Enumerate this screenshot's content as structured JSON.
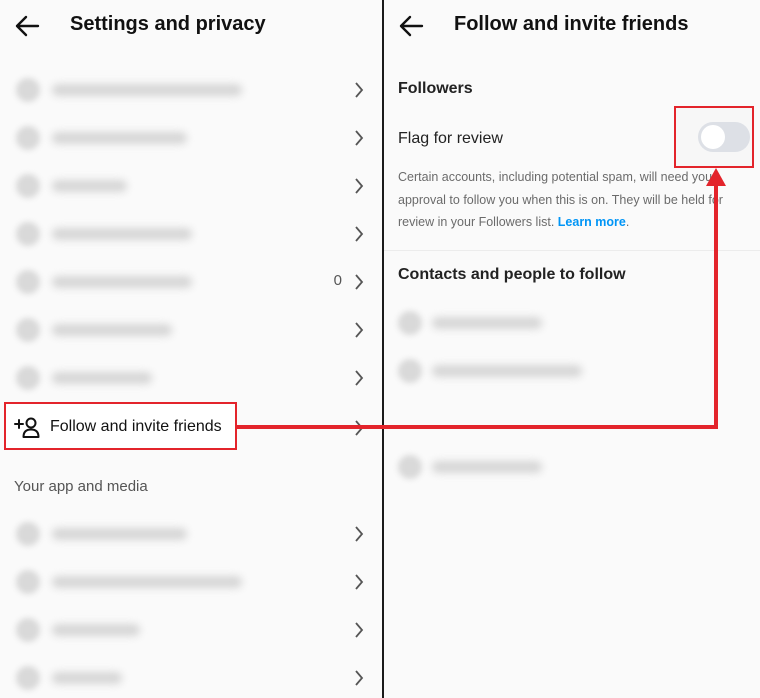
{
  "left": {
    "title": "Settings and privacy",
    "follow_item_label": "Follow and invite friends",
    "restricted_count": "0",
    "section_your_app": "Your app and media"
  },
  "right": {
    "title": "Follow and invite friends",
    "followers_heading": "Followers",
    "flag_label": "Flag for review",
    "flag_toggle_on": false,
    "description": "Certain accounts, including potential spam, will need your approval to follow you when this is on. They will be held for review in your Followers list.",
    "learn_more": "Learn more",
    "contacts_heading": "Contacts and people to follow"
  },
  "colors": {
    "highlight": "#e3242b",
    "link": "#0095f6",
    "toggle_off": "#dde0e6"
  }
}
